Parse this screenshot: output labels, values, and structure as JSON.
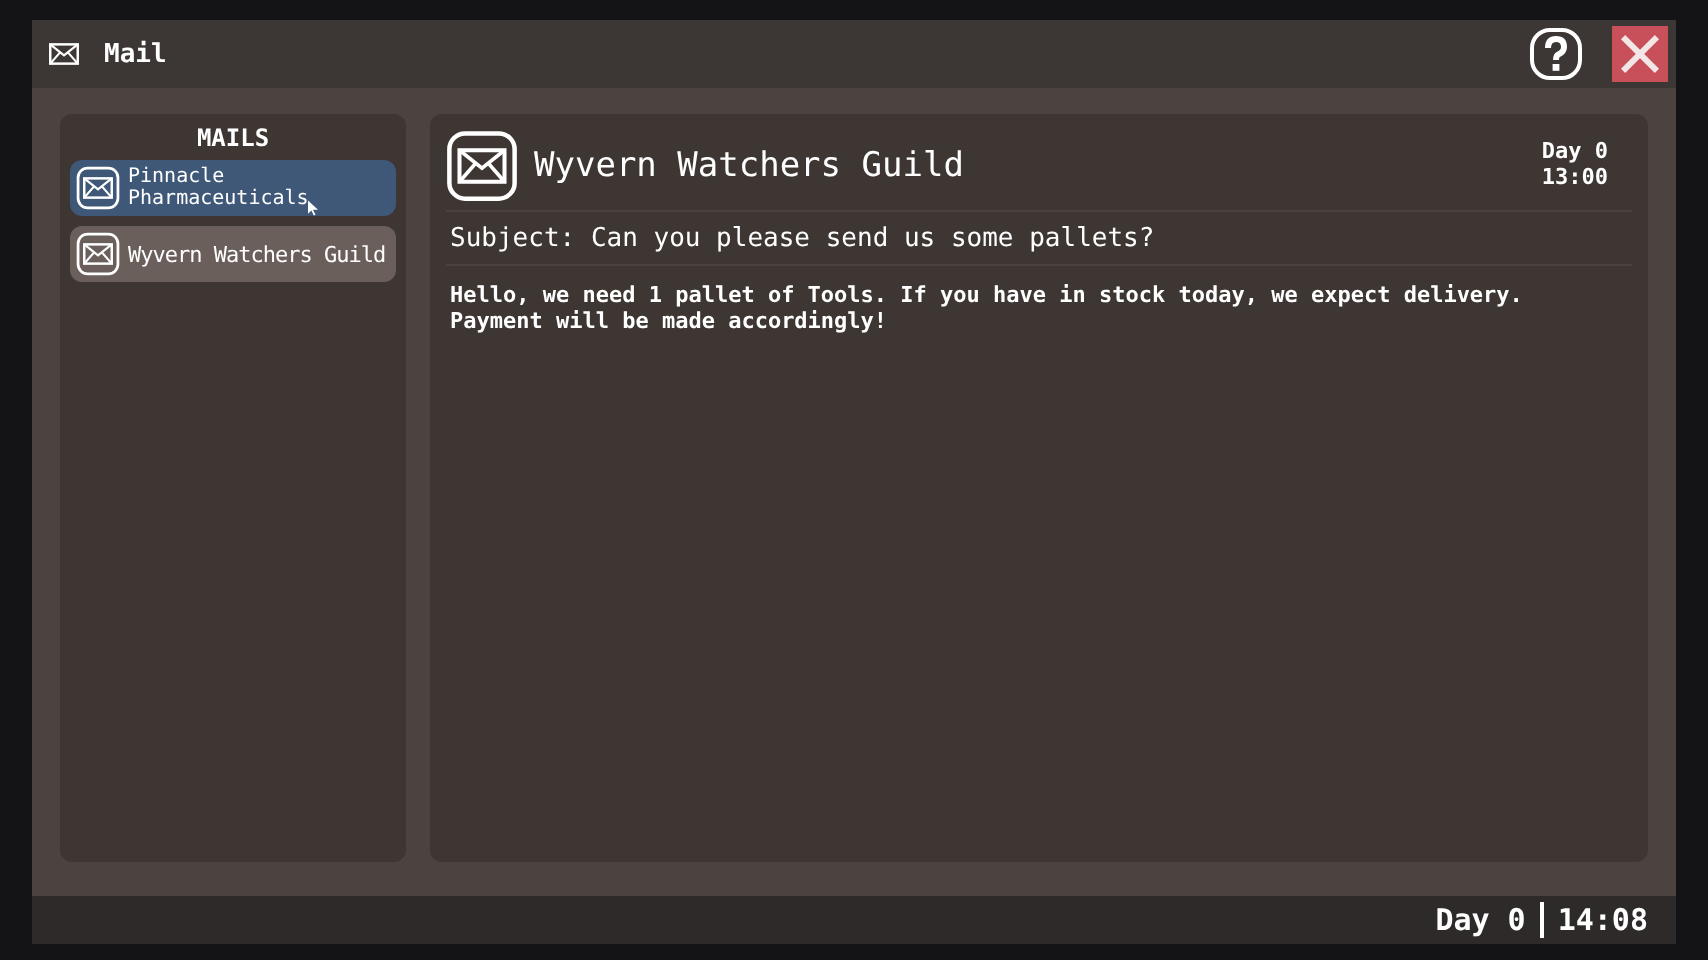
{
  "window": {
    "title": "Mail"
  },
  "sidebar": {
    "heading": "MAILS",
    "items": [
      {
        "label": "Pinnacle Pharmaceuticals",
        "selected": false,
        "hovered": true
      },
      {
        "label": "Wyvern Watchers Guild",
        "selected": true,
        "hovered": false
      }
    ]
  },
  "message": {
    "sender": "Wyvern Watchers Guild",
    "day": "Day 0",
    "time": "13:00",
    "subject": "Subject: Can you please send us some pallets?",
    "body": "Hello, we need 1 pallet of Tools. If you have in stock today, we expect delivery. Payment will be made accordingly!"
  },
  "status_bar": {
    "day": "Day 0",
    "time": "14:08"
  }
}
